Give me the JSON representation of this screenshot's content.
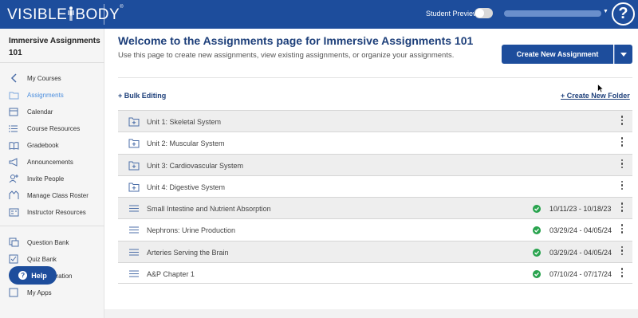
{
  "header": {
    "logo_text": "VISIBLEBODY",
    "student_preview_label": "Student Preview",
    "help_icon": "?"
  },
  "sidebar": {
    "course_name": "Immersive Assignments 101",
    "items": [
      {
        "label": "My Courses",
        "icon": "chevron-left-icon"
      },
      {
        "label": "Assignments",
        "icon": "folder-icon",
        "active": true
      },
      {
        "label": "Calendar",
        "icon": "calendar-icon"
      },
      {
        "label": "Course Resources",
        "icon": "list-icon"
      },
      {
        "label": "Gradebook",
        "icon": "book-icon"
      },
      {
        "label": "Announcements",
        "icon": "megaphone-icon"
      },
      {
        "label": "Invite People",
        "icon": "add-person-icon"
      },
      {
        "label": "Manage Class Roster",
        "icon": "roster-icon"
      },
      {
        "label": "Instructor Resources",
        "icon": "resources-icon"
      }
    ],
    "items2": [
      {
        "label": "Question Bank",
        "icon": "copy-icon"
      },
      {
        "label": "Quiz Bank",
        "icon": "checkbox-icon"
      },
      {
        "label": "LMS Integration",
        "icon": "link-icon"
      },
      {
        "label": "My Apps",
        "icon": "apps-icon"
      }
    ],
    "help_button": "Help"
  },
  "main": {
    "title": "Welcome to the Assignments page for Immersive Assignments 101",
    "subtitle": "Use this page to create new assignments, view existing assignments, or organize your assignments.",
    "create_button": "Create New Assignment",
    "bulk_editing": "+ Bulk Editing",
    "create_folder": "+ Create New Folder"
  },
  "rows": [
    {
      "type": "folder",
      "name": "Unit 1: Skeletal System",
      "dates": "",
      "published": false
    },
    {
      "type": "folder",
      "name": "Unit 2: Muscular System",
      "dates": "",
      "published": false
    },
    {
      "type": "folder",
      "name": "Unit 3: Cardiovascular System",
      "dates": "",
      "published": false
    },
    {
      "type": "folder",
      "name": "Unit 4: Digestive System",
      "dates": "",
      "published": false
    },
    {
      "type": "assignment",
      "name": "Small Intestine and Nutrient Absorption",
      "dates": "10/11/23 - 10/18/23",
      "published": true
    },
    {
      "type": "assignment",
      "name": "Nephrons: Urine Production",
      "dates": "03/29/24 - 04/05/24",
      "published": true
    },
    {
      "type": "assignment",
      "name": "Arteries Serving the Brain",
      "dates": "03/29/24 - 04/05/24",
      "published": true
    },
    {
      "type": "assignment",
      "name": "A&P Chapter 1",
      "dates": "07/10/24 - 07/17/24",
      "published": true
    }
  ],
  "colors": {
    "brand": "#1d4d9c",
    "active_nav": "#4b8ede",
    "status_green": "#2aa44f"
  }
}
